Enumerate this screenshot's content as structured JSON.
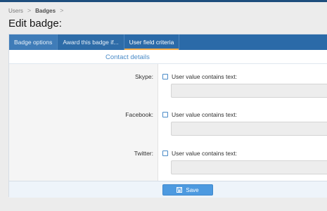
{
  "breadcrumb": {
    "items": [
      "Users",
      "Badges"
    ],
    "separator": ">"
  },
  "page": {
    "title": "Edit badge:"
  },
  "tabs": [
    {
      "label": "Badge options"
    },
    {
      "label": "Award this badge if..."
    },
    {
      "label": "User field criteria",
      "active": true
    }
  ],
  "section": {
    "title": "Contact details"
  },
  "fields": [
    {
      "label": "Skype:",
      "checkbox_label": "User value contains text:",
      "value": ""
    },
    {
      "label": "Facebook:",
      "checkbox_label": "User value contains text:",
      "value": ""
    },
    {
      "label": "Twitter:",
      "checkbox_label": "User value contains text:",
      "value": ""
    }
  ],
  "footer": {
    "save_label": "Save"
  },
  "colors": {
    "accent": "#2b6aa8",
    "button": "#4d9ae0",
    "link": "#4b8bc7"
  },
  "icons": {
    "save": "save-icon",
    "breadcrumb_separator": "chevron-right-icon"
  }
}
